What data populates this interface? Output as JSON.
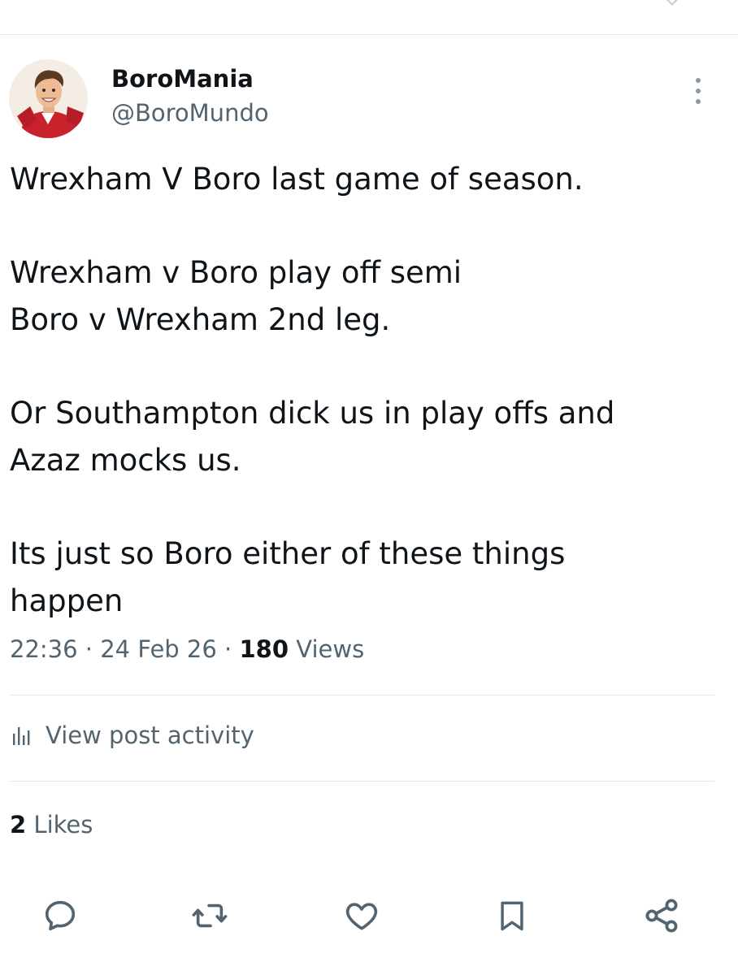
{
  "author": {
    "display_name": "BoroMania",
    "handle": "@BoroMundo"
  },
  "tweet": {
    "paragraphs": [
      [
        "Wrexham V Boro last game of season."
      ],
      [
        "Wrexham v Boro play off semi",
        "Boro v Wrexham 2nd leg."
      ],
      [
        "Or Southampton dick us in play offs and",
        "Azaz mocks us."
      ],
      [
        "Its just so Boro either of these things",
        "happen"
      ]
    ]
  },
  "meta": {
    "time": "22:36",
    "date": "24 Feb 26",
    "separator": "·",
    "views_count": "180",
    "views_label": "Views"
  },
  "post_activity": {
    "label": "View post activity",
    "icon": "bar-chart-icon"
  },
  "likes": {
    "count": "2",
    "label": "Likes"
  },
  "actions": [
    {
      "icon": "reply-icon"
    },
    {
      "icon": "retweet-icon"
    },
    {
      "icon": "like-icon"
    },
    {
      "icon": "bookmark-icon"
    },
    {
      "icon": "share-icon"
    }
  ],
  "colors": {
    "text": "#0f1419",
    "secondary": "#536471",
    "icon": "#536471",
    "divider": "#e6e9ec"
  }
}
